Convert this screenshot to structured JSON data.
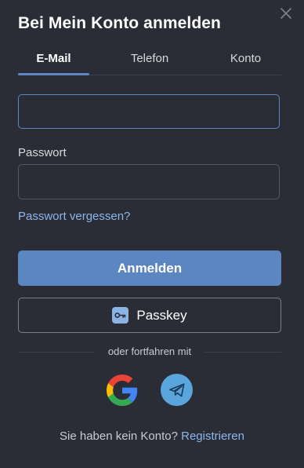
{
  "dialog": {
    "title": "Bei Mein Konto anmelden",
    "close_icon": "close-icon"
  },
  "tabs": [
    {
      "label": "E-Mail",
      "active": true
    },
    {
      "label": "Telefon",
      "active": false
    },
    {
      "label": "Konto",
      "active": false
    }
  ],
  "form": {
    "email_value": "",
    "password_label": "Passwort",
    "password_value": "",
    "forgot_label": "Passwort vergessen?",
    "login_label": "Anmelden",
    "passkey_label": "Passkey",
    "passkey_icon": "key-icon"
  },
  "social": {
    "divider_text": "oder fortfahren mit",
    "providers": [
      {
        "icon": "google-icon"
      },
      {
        "icon": "telegram-icon"
      }
    ]
  },
  "signup": {
    "prompt": "Sie haben kein Konto?",
    "link_label": "Registrieren"
  },
  "colors": {
    "background": "#2a2d35",
    "accent": "#5b86c2",
    "link": "#8cb6ea",
    "telegram": "#5aa5dc"
  }
}
